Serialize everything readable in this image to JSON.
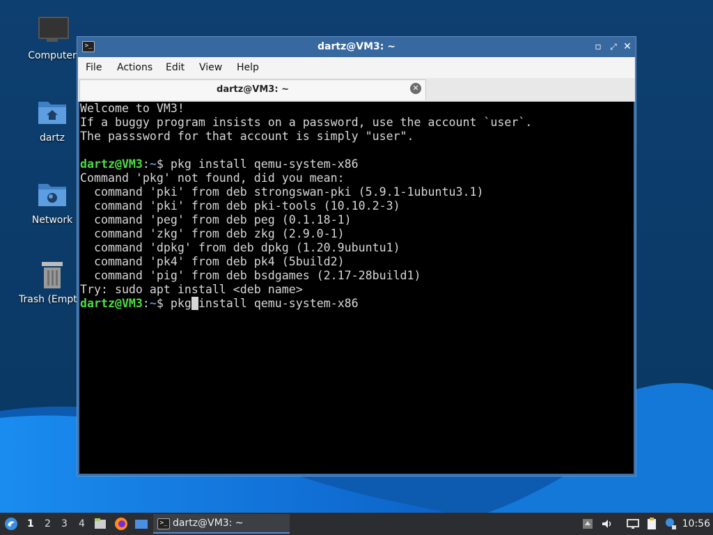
{
  "desktop": {
    "icons": [
      {
        "label": "Computer"
      },
      {
        "label": "dartz"
      },
      {
        "label": "Network"
      },
      {
        "label": "Trash (Empty)"
      }
    ]
  },
  "window": {
    "title": "dartz@VM3: ~",
    "menu": [
      "File",
      "Actions",
      "Edit",
      "View",
      "Help"
    ],
    "tab_title": "dartz@VM3: ~"
  },
  "terminal": {
    "welcome": [
      "Welcome to VM3!",
      "If a buggy program insists on a password, use the account `user`.",
      "The passsword for that account is simply \"user\"."
    ],
    "prompt_user": "dartz@VM3",
    "prompt_path": "~",
    "prompt_sep": ":",
    "prompt_sign": "$ ",
    "command1": "pkg install qemu-system-x86",
    "output": [
      "Command 'pkg' not found, did you mean:",
      "  command 'pki' from deb strongswan-pki (5.9.1-1ubuntu3.1)",
      "  command 'pki' from deb pki-tools (10.10.2-3)",
      "  command 'peg' from deb peg (0.1.18-1)",
      "  command 'zkg' from deb zkg (2.9.0-1)",
      "  command 'dpkg' from deb dpkg (1.20.9ubuntu1)",
      "  command 'pk4' from deb pk4 (5build2)",
      "  command 'pig' from deb bsdgames (2.17-28build1)",
      "Try: sudo apt install <deb name>"
    ],
    "command2_before_cursor": "pkg",
    "command2_after_cursor": "install qemu-system-x86"
  },
  "taskbar": {
    "workspaces": [
      "1",
      "2",
      "3",
      "4"
    ],
    "active_workspace": "1",
    "task_label": "dartz@VM3: ~",
    "clock": "10:56"
  }
}
